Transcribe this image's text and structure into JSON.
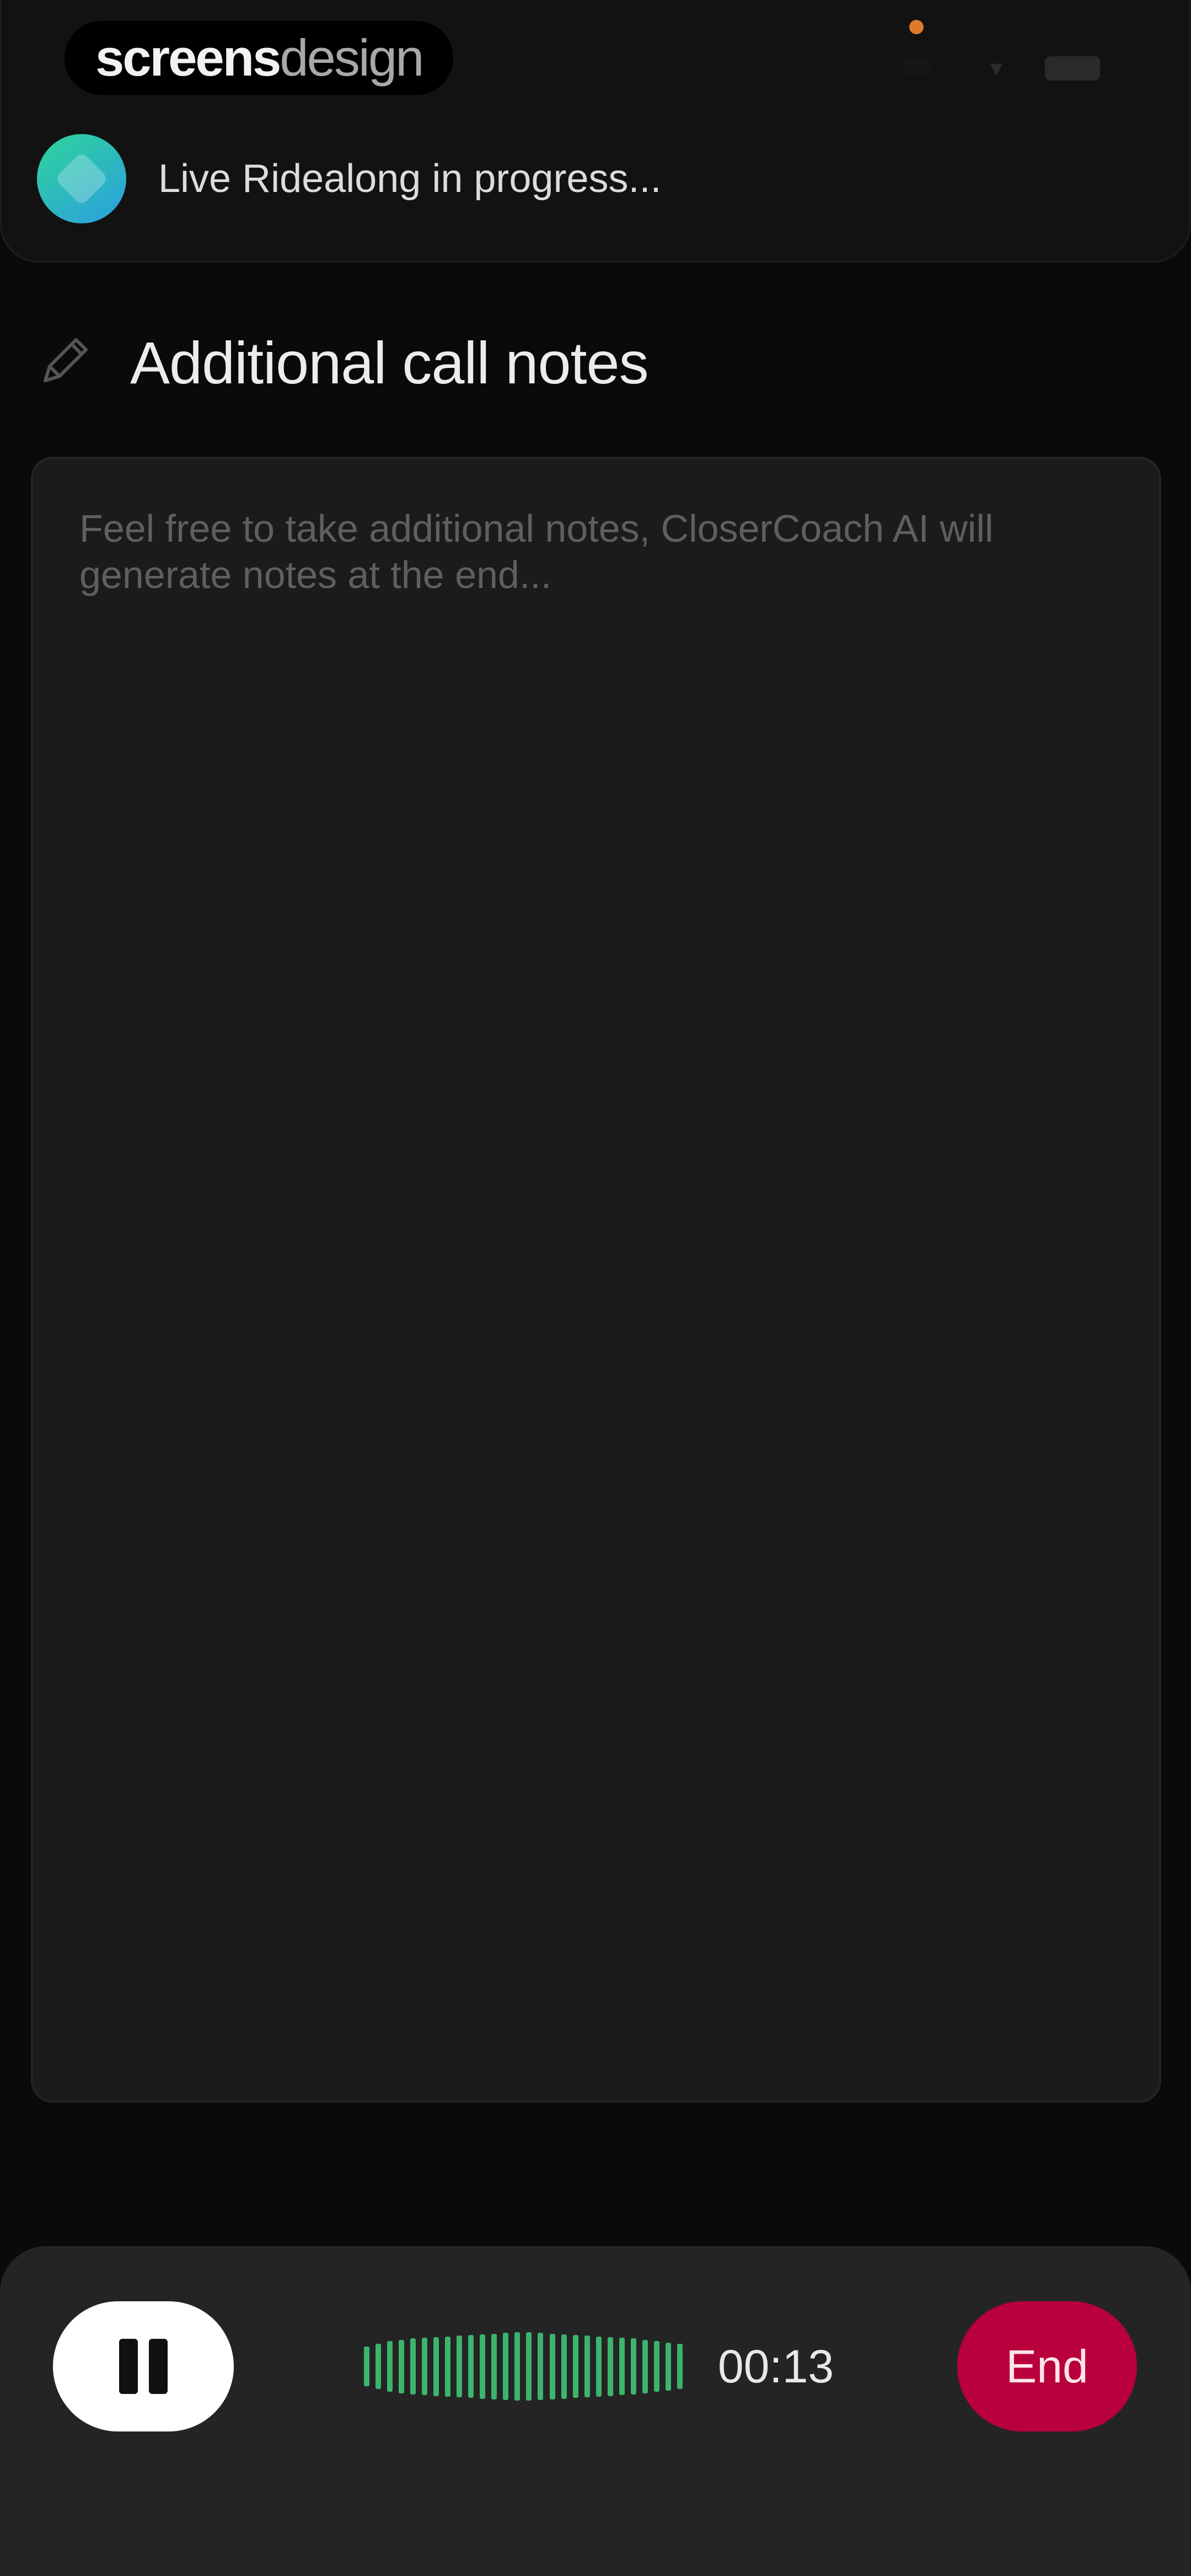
{
  "header": {
    "brand_bold": "screens",
    "brand_light": "design",
    "live_status": "Live Ridealong in progress..."
  },
  "notes": {
    "title": "Additional call notes",
    "placeholder": "Feel free to take additional notes, CloserCoach AI will generate notes at the end...",
    "value": ""
  },
  "controls": {
    "timer": "00:13",
    "end_label": "End",
    "waveform_levels": [
      0.58,
      0.66,
      0.74,
      0.78,
      0.82,
      0.84,
      0.86,
      0.88,
      0.9,
      0.92,
      0.94,
      0.96,
      0.98,
      1.0,
      1.0,
      0.98,
      0.96,
      0.94,
      0.92,
      0.9,
      0.88,
      0.86,
      0.84,
      0.82,
      0.78,
      0.74,
      0.7,
      0.66
    ],
    "waveform_color": "#3cb46e",
    "end_color": "#b8003c"
  },
  "icons": {
    "edit": "pencil-icon",
    "pause": "pause-icon",
    "app": "diamond-avatar-icon"
  }
}
